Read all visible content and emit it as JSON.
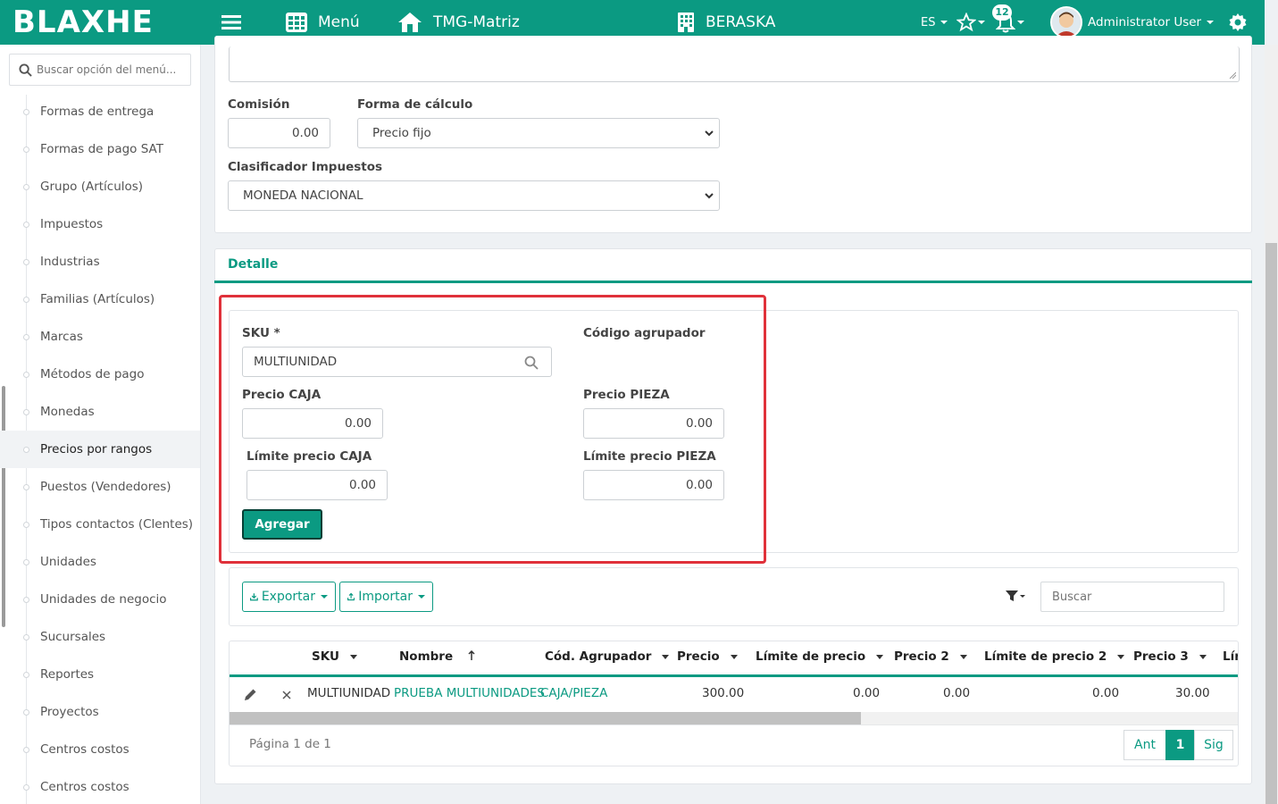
{
  "header": {
    "brand": "BLAXHE",
    "menu_label": "Menú",
    "company": "TMG-Matriz",
    "branch": "BERASKA",
    "language": "ES",
    "notifications_count": "12",
    "user_name": "Administrator User"
  },
  "sidebar": {
    "search_placeholder": "Buscar opción del menú...",
    "items": [
      {
        "label": "Formas de entrega"
      },
      {
        "label": "Formas de pago SAT"
      },
      {
        "label": "Grupo (Artículos)"
      },
      {
        "label": "Impuestos"
      },
      {
        "label": "Industrias"
      },
      {
        "label": "Familias (Artículos)"
      },
      {
        "label": "Marcas"
      },
      {
        "label": "Métodos de pago"
      },
      {
        "label": "Monedas"
      },
      {
        "label": "Precios por rangos"
      },
      {
        "label": "Puestos (Vendedores)"
      },
      {
        "label": "Tipos contactos (Clentes)"
      },
      {
        "label": "Unidades"
      },
      {
        "label": "Unidades de negocio"
      },
      {
        "label": "Sucursales"
      },
      {
        "label": "Reportes"
      },
      {
        "label": "Proyectos"
      },
      {
        "label": "Centros costos"
      },
      {
        "label": "Centros costos"
      }
    ],
    "active_index": 9
  },
  "form": {
    "comision_label": "Comisión",
    "comision_value": "0.00",
    "forma_calculo_label": "Forma de cálculo",
    "forma_calculo_value": "Precio fijo",
    "clasificador_label": "Clasificador Impuestos",
    "clasificador_value": "MONEDA NACIONAL"
  },
  "detalle": {
    "tab_label": "Detalle",
    "sku_label": "SKU *",
    "sku_value": "MULTIUNIDAD",
    "codigo_agrupador_label": "Código agrupador",
    "precio_caja_label": "Precio CAJA",
    "precio_caja_value": "0.00",
    "precio_pieza_label": "Precio PIEZA",
    "precio_pieza_value": "0.00",
    "limite_caja_label": "Límite precio CAJA",
    "limite_caja_value": "0.00",
    "limite_pieza_label": "Límite precio PIEZA",
    "limite_pieza_value": "0.00",
    "agregar_label": "Agregar"
  },
  "toolbar": {
    "exportar_label": "Exportar",
    "importar_label": "Importar",
    "buscar_placeholder": "Buscar"
  },
  "table": {
    "columns": [
      "SKU",
      "Nombre",
      "Cód. Agrupador",
      "Precio",
      "Límite de precio",
      "Precio 2",
      "Límite de precio 2",
      "Precio 3",
      "Lír"
    ],
    "row": {
      "sku": "MULTIUNIDAD",
      "nombre": "PRUEBA MULTIUNIDADES",
      "cod_agrupador": "CAJA/PIEZA",
      "precio": "300.00",
      "limite_precio": "0.00",
      "precio2": "0.00",
      "limite_precio2": "0.00",
      "precio3": "30.00"
    }
  },
  "pager": {
    "info": "Página 1 de 1",
    "prev": "Ant",
    "current": "1",
    "next": "Sig"
  },
  "colors": {
    "primary": "#0b9a82",
    "highlight_border": "#e0313a"
  }
}
